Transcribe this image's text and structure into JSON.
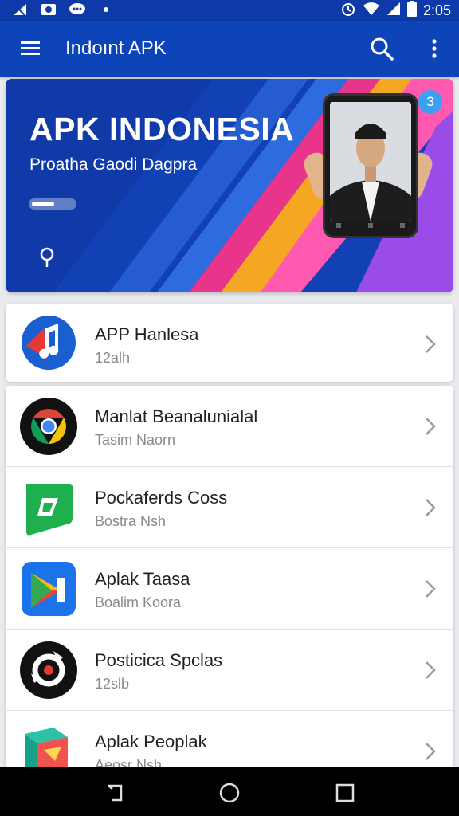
{
  "status_bar": {
    "time": "2:05"
  },
  "app_bar": {
    "title": "Indoınt APK"
  },
  "banner": {
    "title": "APK INDONESIA",
    "subtitle": "Proatha Gaodi Dagpra",
    "badge": "3"
  },
  "featured": {
    "title": "APP Hanlesa",
    "subtitle": "12alh"
  },
  "apps": [
    {
      "title": "Manlat Beanalunialal",
      "subtitle": "Tasim Naorn",
      "icon": "chrome-icon"
    },
    {
      "title": "Pockaferds Coss",
      "subtitle": "Bostra Nsh",
      "icon": "green-play-icon"
    },
    {
      "title": "Aplak Taasa",
      "subtitle": "Boalim Koora",
      "icon": "play-store-icon"
    },
    {
      "title": "Posticica Spclas",
      "subtitle": "12slb",
      "icon": "black-ring-icon"
    },
    {
      "title": "Aplak Peoplak",
      "subtitle": "Aeosr Nsh",
      "icon": "colorful-box-icon"
    }
  ],
  "colors": {
    "primary": "#0d44b8",
    "status": "#0d3aa8",
    "accent_orange": "#f5a623",
    "accent_pink": "#e8348a"
  }
}
